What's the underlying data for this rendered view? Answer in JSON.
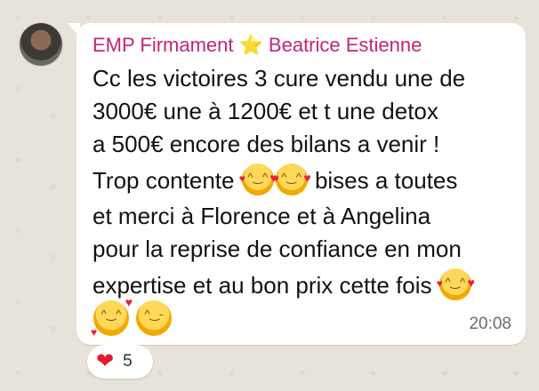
{
  "message": {
    "sender_name": "EMP Firmament",
    "sender_badge_icon": "star-icon",
    "sender_second_name": "Beatrice Estienne",
    "lines": [
      "Cc les victoires 3 cure vendu une de",
      "3000€ une à 1200€ et t une detox",
      "a 500€ encore des bilans a venir !",
      "Trop contente",
      "bises a toutes",
      "et merci à Florence et à Angelina",
      "pour la reprise de confiance en mon",
      "expertise et au bon prix cette fois"
    ],
    "emojis": [
      "smiling-face-with-hearts-icon",
      "winking-face-icon"
    ],
    "timestamp": "20:08"
  },
  "reaction": {
    "icon": "heart-icon",
    "count": "5"
  },
  "colors": {
    "sender": "#c2257a",
    "bubble": "#ffffff",
    "background": "#e7e2da"
  }
}
